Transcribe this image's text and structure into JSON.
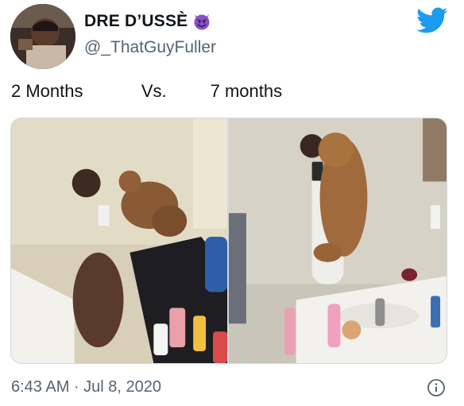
{
  "author": {
    "display_name": "DRE D’USSÈ",
    "emoji": "smiling-imp-emoji",
    "handle": "@_ThatGuyFuller"
  },
  "tweet": {
    "text": "2 Months            Vs.         7 months",
    "timestamp": "6:43 AM · Jul 8, 2020"
  },
  "media": {
    "count": 2,
    "photos": [
      {
        "subject": "man holding small poodle puppy in mirror selfie"
      },
      {
        "subject": "man holding large poodle dog in mirror selfie"
      }
    ]
  },
  "colors": {
    "brand_blue": "#1d9bf0",
    "text_secondary": "#536471",
    "emoji_purple": "#8a4fc7"
  },
  "icons": {
    "platform": "twitter-bird-icon",
    "info": "info-icon"
  }
}
